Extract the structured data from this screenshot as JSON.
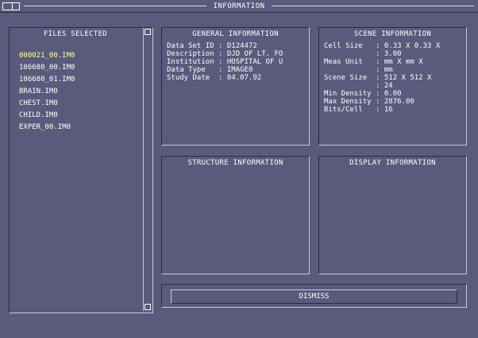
{
  "window": {
    "title": "INFORMATION"
  },
  "files_panel": {
    "title": "FILES SELECTED",
    "items": [
      {
        "label": "000021_00.IM0",
        "selected": true
      },
      {
        "label": "106680_00.IM0",
        "selected": false
      },
      {
        "label": "106680_01.IM0",
        "selected": false
      },
      {
        "label": "BRAIN.IM0",
        "selected": false
      },
      {
        "label": "CHEST.IM0",
        "selected": false
      },
      {
        "label": "CHILD.IM0",
        "selected": false
      },
      {
        "label": "EXPER_00.IM0",
        "selected": false
      }
    ]
  },
  "general_panel": {
    "title": "GENERAL INFORMATION",
    "lines": [
      "Data Set ID : D124472",
      "Description : DJD OF LT. FO",
      "Institution : HOSPITAL OF U",
      "Data Type   : IMAGE0",
      "Study Date  : 04.07.92"
    ]
  },
  "scene_panel": {
    "title": "SCENE INFORMATION",
    "lines": [
      "Cell Size   : 0.33 X 0.33 X",
      "            : 3.00",
      "Meas Unit   : mm X mm X",
      "            : mm",
      "Scene Size  : 512 X 512 X",
      "            : 24",
      "Min Density : 0.00",
      "Max Density : 2876.00",
      "Bits/Cell   : 16"
    ]
  },
  "structure_panel": {
    "title": "STRUCTURE INFORMATION"
  },
  "display_panel": {
    "title": "DISPLAY INFORMATION"
  },
  "actions": {
    "dismiss_label": "DISMISS"
  }
}
